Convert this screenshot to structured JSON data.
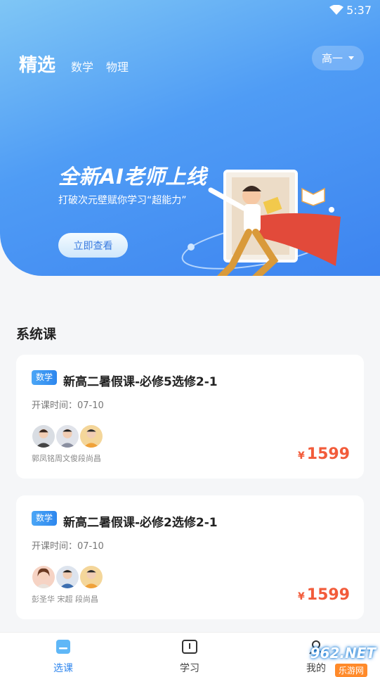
{
  "status_bar": {
    "time": "5:37"
  },
  "header": {
    "tabs": [
      {
        "label": "精选",
        "active": true
      },
      {
        "label": "数学",
        "active": false
      },
      {
        "label": "物理",
        "active": false
      }
    ],
    "grade_select": {
      "value": "高一"
    }
  },
  "banner": {
    "title": "全新AI老师上线",
    "subtitle": "打破次元壁赋你学习“超能力”",
    "button_label": "立即查看"
  },
  "section": {
    "title": "系统课"
  },
  "courses": [
    {
      "badge": "数学",
      "title": "新高二暑假课-必修5选修2-1",
      "date": "开课时间：07-10",
      "teachers": "郭凤铭周文俊段尚昌",
      "price_symbol": "¥",
      "price": "1599"
    },
    {
      "badge": "数学",
      "title": "新高二暑假课-必修2选修2-1",
      "date": "开课时间：07-10",
      "teachers": "彭圣华  宋超  段尚昌",
      "price_symbol": "¥",
      "price": "1599"
    }
  ],
  "tabbar": {
    "items": [
      {
        "label": "选课",
        "active": true,
        "icon": "course-select-icon"
      },
      {
        "label": "学习",
        "active": false,
        "icon": "book-icon"
      },
      {
        "label": "我的",
        "active": false,
        "icon": "profile-icon"
      }
    ]
  },
  "watermark": {
    "text": "962.NET",
    "sub": "乐游网"
  },
  "colors": {
    "accent": "#3d84f0",
    "price": "#f25b3a",
    "active_tab": "#2f86ee"
  }
}
